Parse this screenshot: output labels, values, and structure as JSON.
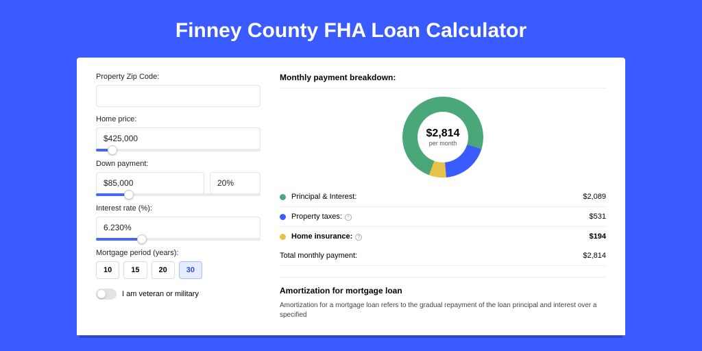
{
  "hero": {
    "title": "Finney County FHA Loan Calculator"
  },
  "form": {
    "zip": {
      "label": "Property Zip Code:",
      "value": ""
    },
    "price": {
      "label": "Home price:",
      "value": "$425,000",
      "slider_pct": 10
    },
    "down": {
      "label": "Down payment:",
      "value": "$85,000",
      "pct_value": "20%",
      "slider_pct": 20
    },
    "rate": {
      "label": "Interest rate (%):",
      "value": "6.230%",
      "slider_pct": 28
    },
    "period": {
      "label": "Mortgage period (years):",
      "options": [
        "10",
        "15",
        "20",
        "30"
      ],
      "selected": "30"
    },
    "veteran_label": "I am veteran or military"
  },
  "breakdown": {
    "title": "Monthly payment breakdown:",
    "center_amount": "$2,814",
    "center_sub": "per month",
    "rows": [
      {
        "dot": "green",
        "label": "Principal & Interest:",
        "info": false,
        "value": "$2,089"
      },
      {
        "dot": "blue",
        "label": "Property taxes:",
        "info": true,
        "value": "$531"
      },
      {
        "dot": "yellow",
        "label": "Home insurance:",
        "info": true,
        "value": "$194"
      }
    ],
    "total_label": "Total monthly payment:",
    "total_value": "$2,814"
  },
  "chart_data": {
    "type": "pie",
    "title": "Monthly payment breakdown:",
    "series": [
      {
        "name": "Principal & Interest",
        "value": 2089,
        "color": "#4aa77a"
      },
      {
        "name": "Property taxes",
        "value": 531,
        "color": "#3a5bff"
      },
      {
        "name": "Home insurance",
        "value": 194,
        "color": "#e8c24b"
      }
    ],
    "center_label": "$2,814 per month"
  },
  "amort": {
    "title": "Amortization for mortgage loan",
    "text": "Amortization for a mortgage loan refers to the gradual repayment of the loan principal and interest over a specified"
  }
}
